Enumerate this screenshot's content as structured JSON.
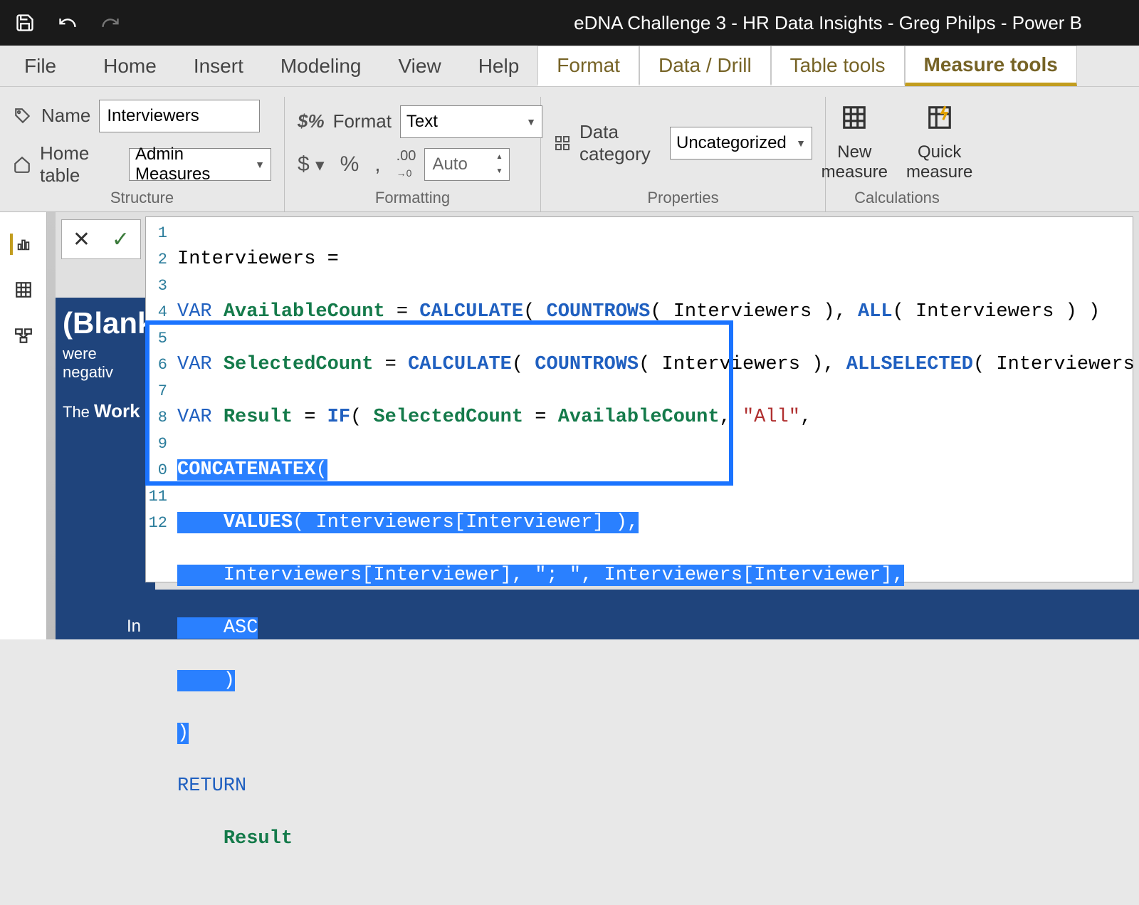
{
  "titlebar": {
    "title": "eDNA Challenge 3 - HR Data Insights - Greg Philps - Power B"
  },
  "menu": {
    "file": "File",
    "home": "Home",
    "insert": "Insert",
    "modeling": "Modeling",
    "view": "View",
    "help": "Help",
    "format": "Format",
    "datadrill": "Data / Drill",
    "tabletools": "Table tools",
    "measuretools": "Measure tools"
  },
  "ribbon": {
    "structure": {
      "caption": "Structure",
      "name_label": "Name",
      "name_value": "Interviewers",
      "hometable_label": "Home table",
      "hometable_value": "Admin Measures"
    },
    "formatting": {
      "caption": "Formatting",
      "format_label": "Format",
      "format_value": "Text",
      "auto_value": "Auto"
    },
    "properties": {
      "caption": "Properties",
      "datacat_label": "Data category",
      "datacat_value": "Uncategorized"
    },
    "calcs": {
      "caption": "Calculations",
      "newmeasure_l1": "New",
      "newmeasure_l2": "measure",
      "quickmeasure_l1": "Quick",
      "quickmeasure_l2": "measure"
    }
  },
  "report": {
    "blank": "(Blank)",
    "neg": "were negativ",
    "work_pre": "The ",
    "work_bold": "Work",
    "strip_label": "In"
  },
  "code": {
    "lines": [
      "Interviewers =",
      "VAR AvailableCount = CALCULATE( COUNTROWS( Interviewers ), ALL( Interviewers ) )",
      "VAR SelectedCount = CALCULATE( COUNTROWS( Interviewers ), ALLSELECTED( Interviewers ) )",
      "VAR Result = IF( SelectedCount = AvailableCount, \"All\",",
      "CONCATENATEX(",
      "    VALUES( Interviewers[Interviewer] ),",
      "    Interviewers[Interviewer], \"; \", Interviewers[Interviewer],",
      "    ASC",
      "    )",
      ")",
      "RETURN",
      "    Result"
    ],
    "linenumbers": [
      "1",
      "2",
      "3",
      "4",
      "5",
      "6",
      "7",
      "8",
      "9",
      "0",
      "11",
      "12"
    ]
  },
  "chart_data": null
}
